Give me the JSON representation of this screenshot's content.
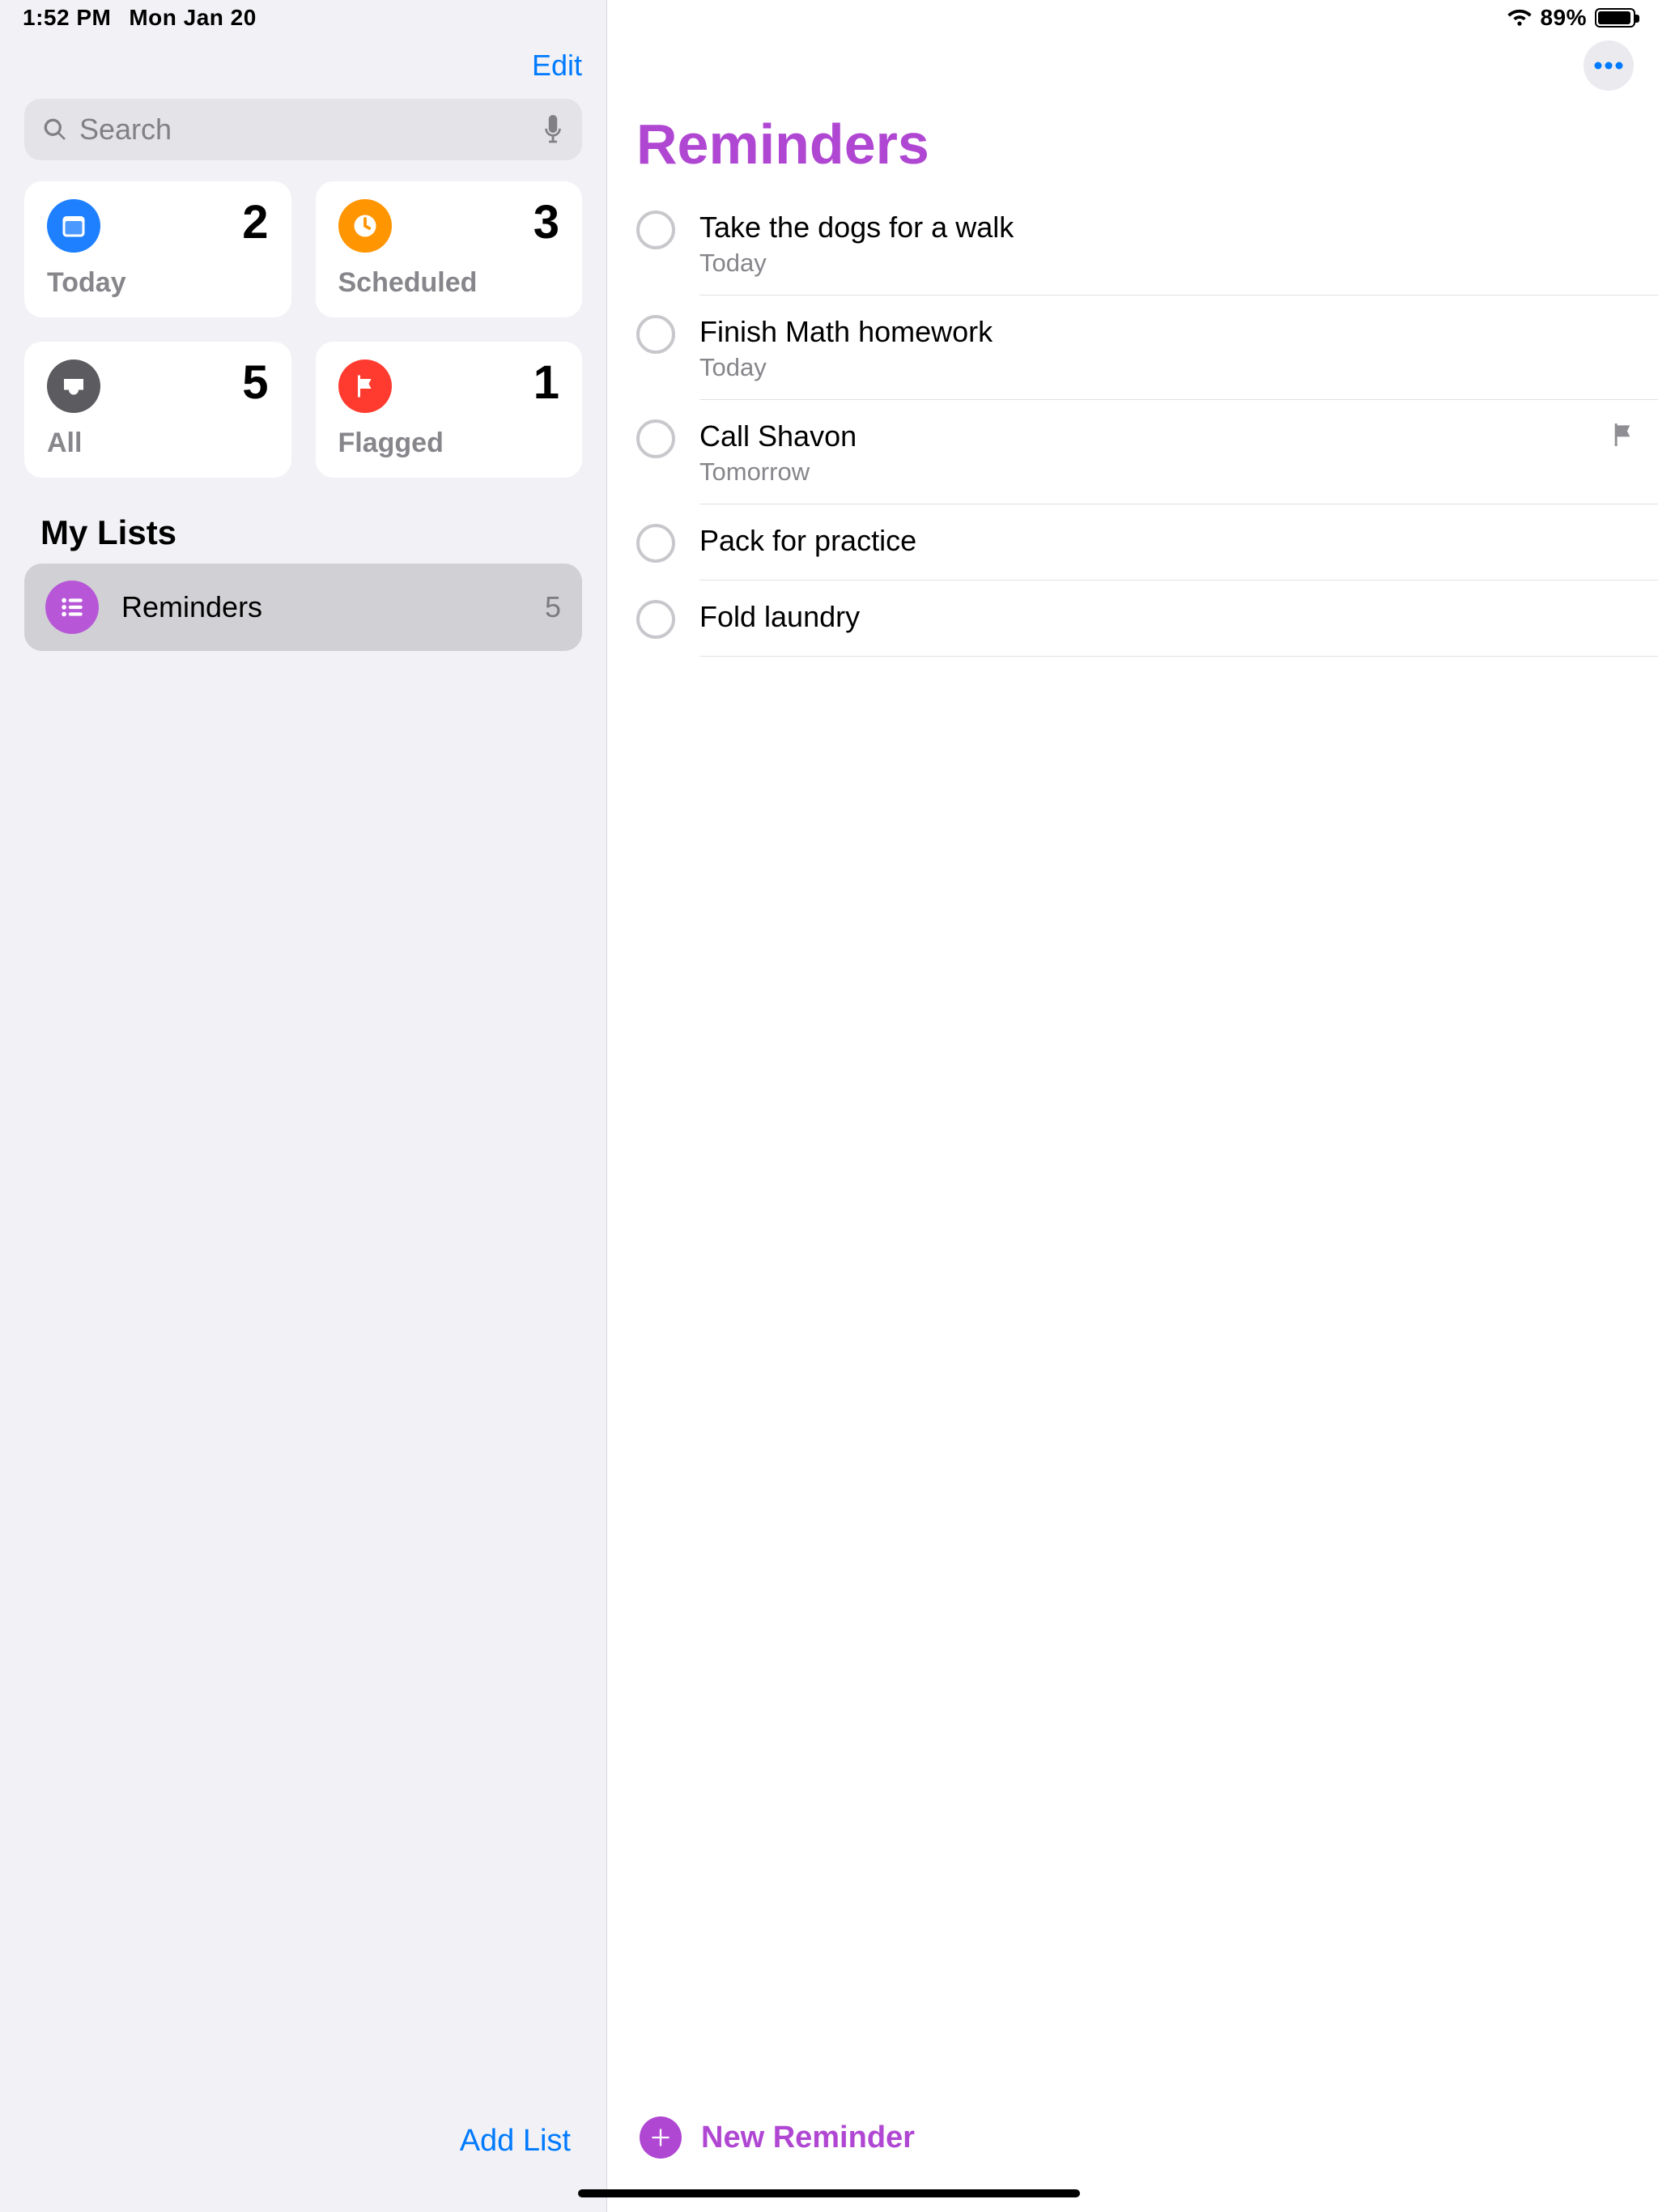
{
  "status": {
    "time": "1:52 PM",
    "date": "Mon Jan 20",
    "battery_pct": "89%"
  },
  "sidebar": {
    "edit_label": "Edit",
    "search_placeholder": "Search",
    "smart": [
      {
        "label": "Today",
        "count": "2"
      },
      {
        "label": "Scheduled",
        "count": "3"
      },
      {
        "label": "All",
        "count": "5"
      },
      {
        "label": "Flagged",
        "count": "1"
      }
    ],
    "section_title": "My Lists",
    "lists": [
      {
        "name": "Reminders",
        "count": "5",
        "color": "#b757d8",
        "selected": true
      }
    ],
    "add_list_label": "Add List"
  },
  "main": {
    "title": "Reminders",
    "title_color": "#b047d3",
    "reminders": [
      {
        "title": "Take the dogs for a walk",
        "sub": "Today",
        "flagged": false
      },
      {
        "title": "Finish Math homework",
        "sub": "Today",
        "flagged": false
      },
      {
        "title": "Call Shavon",
        "sub": "Tomorrow",
        "flagged": true
      },
      {
        "title": "Pack for practice",
        "sub": "",
        "flagged": false
      },
      {
        "title": "Fold laundry",
        "sub": "",
        "flagged": false
      }
    ],
    "new_reminder_label": "New Reminder"
  }
}
